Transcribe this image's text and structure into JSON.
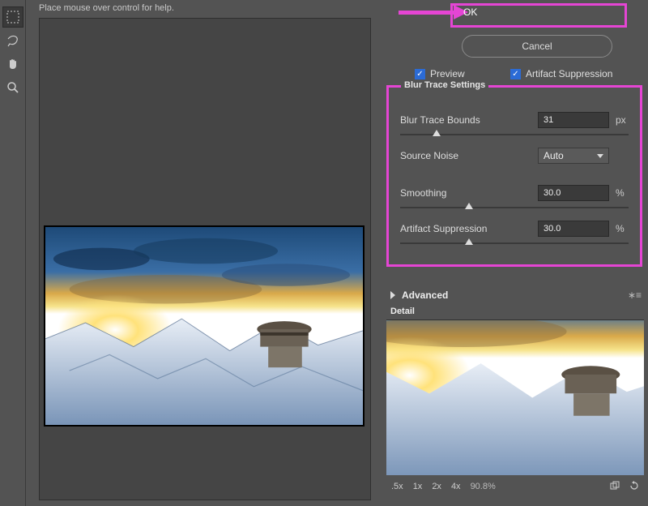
{
  "help_text": "Place mouse over control for help.",
  "dialog": {
    "ok_label": "OK",
    "cancel_label": "Cancel"
  },
  "checks": {
    "preview_label": "Preview",
    "preview_checked": true,
    "artifact_label": "Artifact Suppression",
    "artifact_checked": true
  },
  "settings": {
    "title": "Blur Trace Settings",
    "bounds_label": "Blur Trace Bounds",
    "bounds_value": "31",
    "bounds_unit": "px",
    "noise_label": "Source Noise",
    "noise_value": "Auto",
    "smoothing_label": "Smoothing",
    "smoothing_value": "30.0",
    "smoothing_unit": "%",
    "artifact_label": "Artifact Suppression",
    "artifact_value": "30.0",
    "artifact_unit": "%"
  },
  "advanced_label": "Advanced",
  "detail_label": "Detail",
  "zoom": {
    "z05": ".5x",
    "z1": "1x",
    "z2": "2x",
    "z4": "4x",
    "pct": "90.8%"
  }
}
